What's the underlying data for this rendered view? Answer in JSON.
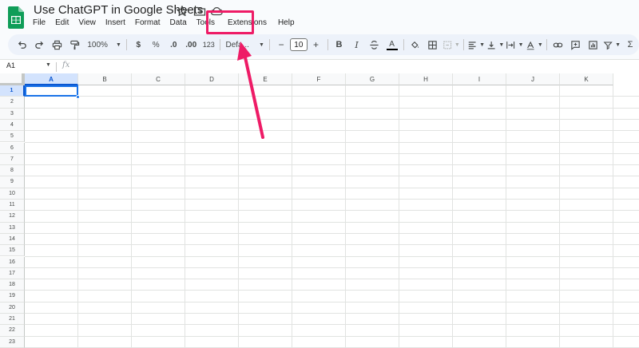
{
  "document": {
    "title": "Use ChatGPT in Google Sheets"
  },
  "menu": {
    "items": [
      "File",
      "Edit",
      "View",
      "Insert",
      "Format",
      "Data",
      "Tools",
      "Extensions",
      "Help"
    ]
  },
  "toolbar": {
    "zoom": "100%",
    "currency": "$",
    "percent": "%",
    "decrease_decimal": ".0",
    "increase_decimal": ".00",
    "number_format": "123",
    "font": "Defa...",
    "font_size": "10",
    "minus": "−",
    "plus": "+",
    "bold": "B",
    "italic": "I",
    "text_color": "A",
    "function": "Σ"
  },
  "formula_bar": {
    "cell_ref": "A1",
    "fx": "fx"
  },
  "grid": {
    "columns": [
      "A",
      "B",
      "C",
      "D",
      "E",
      "F",
      "G",
      "H",
      "I",
      "J",
      "K"
    ],
    "rows": [
      "1",
      "2",
      "3",
      "4",
      "5",
      "6",
      "7",
      "8",
      "9",
      "10",
      "11",
      "12",
      "13",
      "14",
      "15",
      "16",
      "17",
      "18",
      "19",
      "20",
      "21",
      "22",
      "23"
    ],
    "selected_cell": "A1"
  },
  "colors": {
    "accent": "#1a73e8",
    "annotation": "#ee1b66",
    "sheets_green": "#0f9d58"
  }
}
